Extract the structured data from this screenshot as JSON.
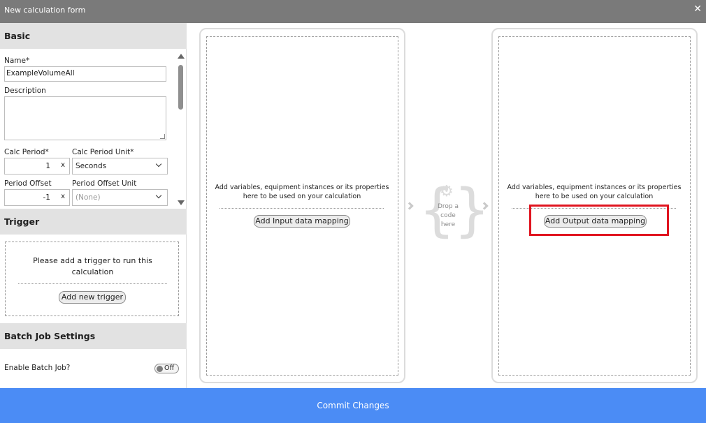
{
  "window": {
    "title": "New calculation form",
    "close_glyph": "✕"
  },
  "basic": {
    "heading": "Basic",
    "name_label": "Name*",
    "name_value": "ExampleVolumeAll",
    "description_label": "Description",
    "description_value": "",
    "calc_period_label": "Calc Period*",
    "calc_period_value": "1",
    "calc_period_clear": "x",
    "calc_period_unit_label": "Calc Period Unit*",
    "calc_period_unit_value": "Seconds",
    "period_offset_label": "Period Offset",
    "period_offset_value": "-1",
    "period_offset_clear": "x",
    "period_offset_unit_label": "Period Offset Unit",
    "period_offset_unit_value": "(None)"
  },
  "trigger": {
    "heading": "Trigger",
    "message": "Please add a trigger to run this calculation",
    "add_button": "Add new trigger"
  },
  "batch": {
    "heading": "Batch Job Settings",
    "enable_label": "Enable Batch Job?",
    "toggle_state": "Off"
  },
  "input_panel": {
    "message": "Add variables, equipment instances or its properties here to be used on your calculation",
    "button": "Add Input data mapping"
  },
  "code_drop": {
    "text": "Drop a code here",
    "icon": "gear-icon"
  },
  "output_panel": {
    "message": "Add variables, equipment instances or its properties here to be used on your calculation",
    "button": "Add Output data mapping"
  },
  "footer": {
    "commit_label": "Commit Changes"
  },
  "colors": {
    "titlebar": "#7a7a7a",
    "footer": "#4b8cf5",
    "highlight": "#e0141f",
    "section_header": "#e2e2e2"
  }
}
